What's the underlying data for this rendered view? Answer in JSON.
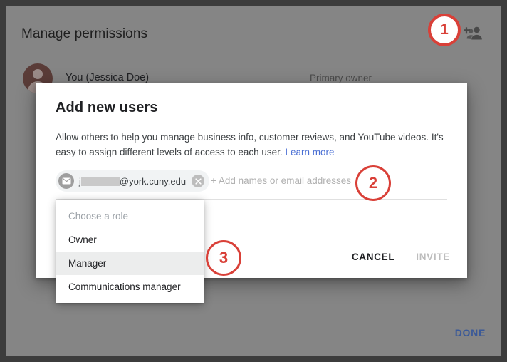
{
  "page": {
    "title": "Manage permissions",
    "add_user_icon": "add-people-icon",
    "user": {
      "name": "You (Jessica Doe)",
      "role": "Primary owner",
      "avatar_icon": "person-avatar-icon"
    },
    "done_label": "DONE"
  },
  "dialog": {
    "title": "Add new users",
    "description_line1": "Allow others to help you manage business info, customer reviews, and YouTube videos.",
    "description_line2": "It's easy to assign different levels of access to each user. ",
    "learn_more_label": "Learn more",
    "chip": {
      "envelope_icon": "envelope-icon",
      "email_prefix": "j",
      "email_domain": "@york.cuny.edu",
      "remove_icon": "close-circle-icon"
    },
    "input_placeholder": "+ Add names or email addresses",
    "cancel_label": "CANCEL",
    "invite_label": "INVITE"
  },
  "role_dropdown": {
    "placeholder": "Choose a role",
    "options": [
      {
        "label": "Owner",
        "selected": false
      },
      {
        "label": "Manager",
        "selected": true
      },
      {
        "label": "Communications manager",
        "selected": false
      }
    ]
  },
  "annotations": {
    "badge1": "1",
    "badge2": "2",
    "badge3": "3",
    "color": "#d94038"
  },
  "colors": {
    "scrim": "#858585",
    "dialog_bg": "#ffffff",
    "link": "#4a6fd4",
    "done_link": "#3a5998",
    "selected_row": "#eceded"
  }
}
